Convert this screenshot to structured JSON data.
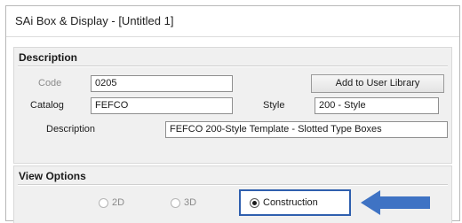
{
  "window": {
    "title": "SAi Box & Display - [Untitled 1]"
  },
  "description_section": {
    "header": "Description",
    "code_label": "Code",
    "code_value": "0205",
    "add_button_label": "Add to User Library",
    "catalog_label": "Catalog",
    "catalog_value": "FEFCO",
    "style_label": "Style",
    "style_value": "200 - Style",
    "description_label": "Description",
    "description_value": "FEFCO 200-Style Template - Slotted Type Boxes"
  },
  "view_options": {
    "header": "View Options",
    "options": [
      {
        "label": "2D",
        "selected": false
      },
      {
        "label": "3D",
        "selected": false
      },
      {
        "label": "Construction",
        "selected": true
      }
    ]
  },
  "colors": {
    "highlight_border": "#2f5fae",
    "arrow_fill": "#3f73c4"
  },
  "icons": {
    "pointer": "arrow-left-icon"
  }
}
